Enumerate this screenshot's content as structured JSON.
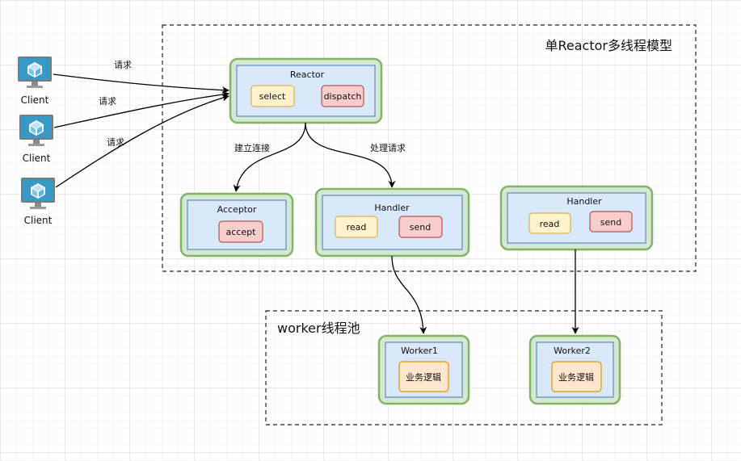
{
  "regions": {
    "reactor_model_title": "单Reactor多线程模型",
    "worker_pool_title": "worker线程池"
  },
  "clients": [
    {
      "label": "Client",
      "request_label": "请求"
    },
    {
      "label": "Client",
      "request_label": "请求"
    },
    {
      "label": "Client",
      "request_label": "请求"
    }
  ],
  "reactor": {
    "title": "Reactor",
    "select_label": "select",
    "dispatch_label": "dispatch"
  },
  "edges": {
    "connect_label": "建立连接",
    "process_label": "处理请求"
  },
  "acceptor": {
    "title": "Acceptor",
    "accept_label": "accept"
  },
  "handlers": [
    {
      "title": "Handler",
      "read_label": "read",
      "send_label": "send"
    },
    {
      "title": "Handler",
      "read_label": "read",
      "send_label": "send"
    }
  ],
  "workers": [
    {
      "title": "Worker1",
      "task_label": "业务逻辑"
    },
    {
      "title": "Worker2",
      "task_label": "业务逻辑"
    }
  ],
  "colors": {
    "outer_fill": "#d5e8d4",
    "outer_stroke": "#82b366",
    "inner_fill": "#dae8fc",
    "inner_stroke": "#6c8ebf",
    "yellow_fill": "#fff2cc",
    "red_fill": "#f8cecc",
    "orange_fill": "#ffe6cc",
    "monitor_blue": "#3999c6"
  },
  "icons": {
    "client": "computer-monitor-icon"
  }
}
